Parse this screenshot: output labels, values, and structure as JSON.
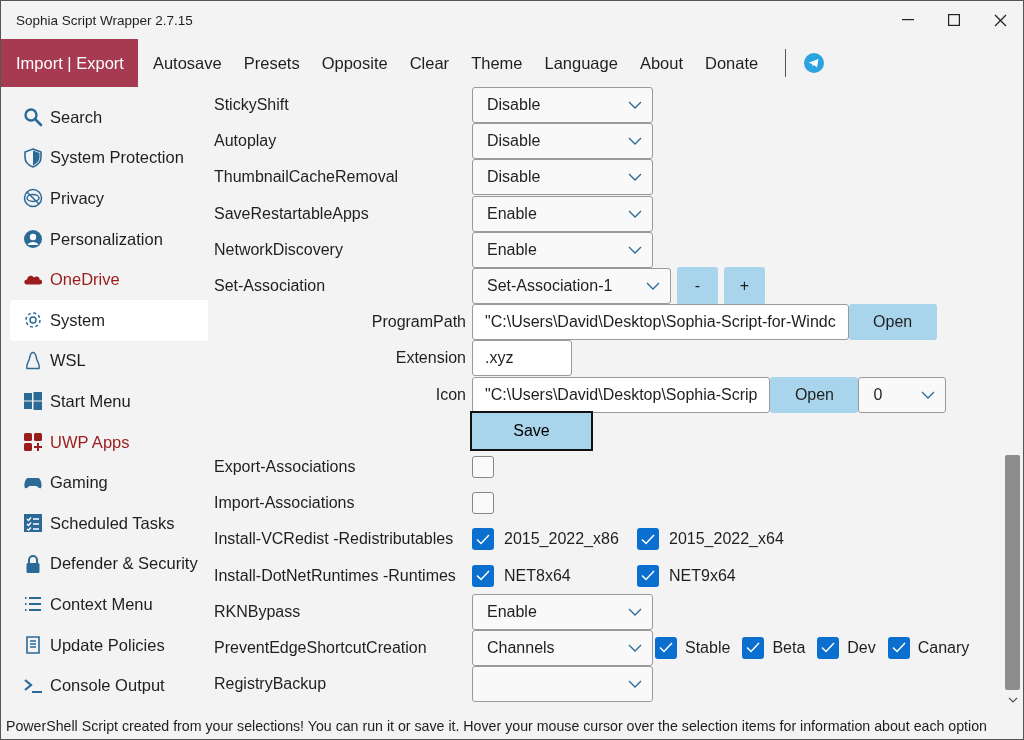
{
  "window": {
    "title": "Sophia Script Wrapper 2.7.15"
  },
  "menu": [
    {
      "label": "Import | Export",
      "selected": true
    },
    {
      "label": "Autosave",
      "selected": false
    },
    {
      "label": "Presets",
      "selected": false
    },
    {
      "label": "Opposite",
      "selected": false
    },
    {
      "label": "Clear",
      "selected": false
    },
    {
      "label": "Theme",
      "selected": false
    },
    {
      "label": "Language",
      "selected": false
    },
    {
      "label": "About",
      "selected": false
    },
    {
      "label": "Donate",
      "selected": false
    }
  ],
  "sidebar": {
    "items": [
      {
        "label": "Search",
        "selected": false,
        "color": "#1f1f1f"
      },
      {
        "label": "System Protection",
        "selected": false,
        "color": "#1f1f1f"
      },
      {
        "label": "Privacy",
        "selected": false,
        "color": "#1f1f1f"
      },
      {
        "label": "Personalization",
        "selected": false,
        "color": "#1f1f1f"
      },
      {
        "label": "OneDrive",
        "selected": false,
        "color": "#9b1c1c"
      },
      {
        "label": "System",
        "selected": true,
        "color": "#1f1f1f"
      },
      {
        "label": "WSL",
        "selected": false,
        "color": "#1f1f1f"
      },
      {
        "label": "Start Menu",
        "selected": false,
        "color": "#1f1f1f"
      },
      {
        "label": "UWP Apps",
        "selected": false,
        "color": "#9b1c1c"
      },
      {
        "label": "Gaming",
        "selected": false,
        "color": "#1f1f1f"
      },
      {
        "label": "Scheduled Tasks",
        "selected": false,
        "color": "#1f1f1f"
      },
      {
        "label": "Defender & Security",
        "selected": false,
        "color": "#1f1f1f"
      },
      {
        "label": "Context Menu",
        "selected": false,
        "color": "#1f1f1f"
      },
      {
        "label": "Update Policies",
        "selected": false,
        "color": "#1f1f1f"
      },
      {
        "label": "Console Output",
        "selected": false,
        "color": "#1f1f1f"
      }
    ]
  },
  "settings": [
    {
      "kind": "dropdown",
      "label": "StickyShift",
      "value": "Disable"
    },
    {
      "kind": "dropdown",
      "label": "Autoplay",
      "value": "Disable"
    },
    {
      "kind": "dropdown",
      "label": "ThumbnailCacheRemoval",
      "value": "Disable"
    },
    {
      "kind": "dropdown",
      "label": "SaveRestartableApps",
      "value": "Enable"
    },
    {
      "kind": "dropdown",
      "label": "NetworkDiscovery",
      "value": "Enable"
    },
    {
      "kind": "association",
      "label": "Set-Association",
      "value": "Set-Association-1",
      "buttons": [
        "-",
        "+"
      ]
    },
    {
      "kind": "path",
      "label": "ProgramPath",
      "value": "\"C:\\Users\\David\\Desktop\\Sophia-Script-for-Windc",
      "button": "Open"
    },
    {
      "kind": "field",
      "label": "Extension",
      "value": ".xyz"
    },
    {
      "kind": "icon-path",
      "label": "Icon",
      "value": "\"C:\\Users\\David\\Desktop\\Sophia-Scrip",
      "button": "Open",
      "index": "0"
    },
    {
      "kind": "save",
      "button": "Save"
    },
    {
      "kind": "checkbox",
      "label": "Export-Associations",
      "checked": false
    },
    {
      "kind": "checkbox",
      "label": "Import-Associations",
      "checked": false
    },
    {
      "kind": "checkboxes",
      "label": "Install-VCRedist -Redistributables",
      "options": [
        {
          "label": "2015_2022_x86",
          "checked": true
        },
        {
          "label": "2015_2022_x64",
          "checked": true
        }
      ]
    },
    {
      "kind": "checkboxes",
      "label": "Install-DotNetRuntimes -Runtimes",
      "options": [
        {
          "label": "NET8x64",
          "checked": true
        },
        {
          "label": "NET9x64",
          "checked": true
        }
      ]
    },
    {
      "kind": "dropdown",
      "label": "RKNBypass",
      "value": "Enable"
    },
    {
      "kind": "dropdown-checkboxes",
      "label": "PreventEdgeShortcutCreation",
      "value": "Channels",
      "options": [
        {
          "label": "Stable",
          "checked": true
        },
        {
          "label": "Beta",
          "checked": true
        },
        {
          "label": "Dev",
          "checked": true
        },
        {
          "label": "Canary",
          "checked": true
        }
      ]
    },
    {
      "kind": "dropdown",
      "label": "RegistryBackup"
    }
  ],
  "status_bar": "PowerShell Script created from your selections! You can run it or save it. Hover your mouse cursor over the selection items for information about each option"
}
